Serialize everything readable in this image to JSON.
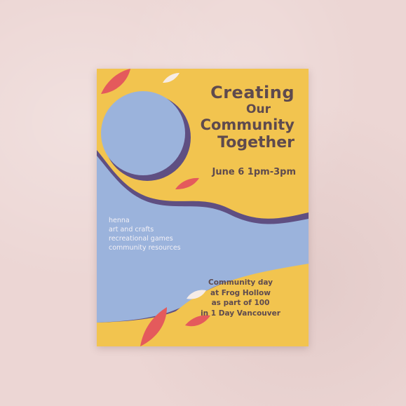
{
  "poster": {
    "title_lines": [
      "Creating",
      "Our",
      "Community",
      "Together"
    ],
    "date_time": "June 6 1pm-3pm",
    "activities": [
      "henna",
      "art and crafts",
      "recreational games",
      "community resources"
    ],
    "info_lines": [
      "Community day",
      "at Frog Hollow",
      "as part of 100",
      "in 1 Day Vancouver"
    ]
  },
  "colors": {
    "wall": "#ecd6d4",
    "poster_yellow": "#f2c44f",
    "poster_blue": "#9bb3dc",
    "shadow_purple": "#5f4f82",
    "text_brown": "#5e4a4e",
    "leaf_red": "#e45a5c",
    "leaf_white": "#f6ece6"
  }
}
